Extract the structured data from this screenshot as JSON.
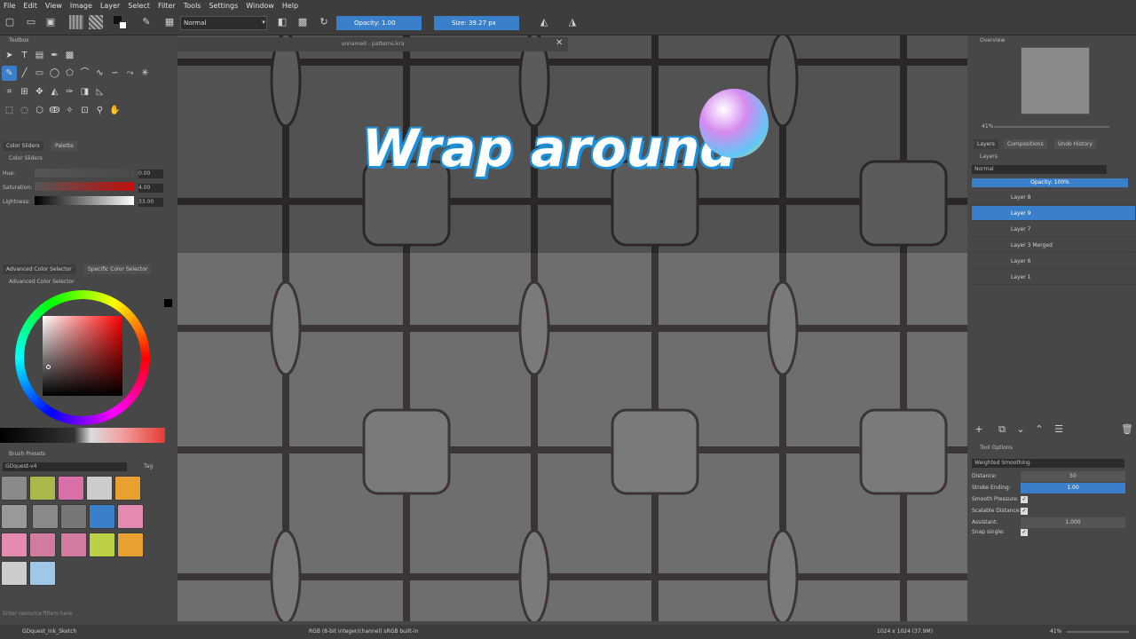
{
  "menu": [
    "File",
    "Edit",
    "View",
    "Image",
    "Layer",
    "Select",
    "Filter",
    "Tools",
    "Settings",
    "Window",
    "Help"
  ],
  "toolbar": {
    "blend_mode": "Normal",
    "opacity_label": "Opacity:  1.00",
    "size_label": "Size:  39.27 px"
  },
  "document": {
    "tab_title": "unnamed - patterns.kra"
  },
  "left": {
    "toolbox_title": "Toolbox",
    "color_tabs": [
      "Color Sliders",
      "Palette"
    ],
    "color_sliders_title": "Color Sliders",
    "sliders": [
      {
        "label": "Hue:",
        "value": "0.00"
      },
      {
        "label": "Saturation:",
        "value": "4.00"
      },
      {
        "label": "Lightness:",
        "value": "33.00"
      }
    ],
    "selector_tabs": [
      "Advanced Color Selector",
      "Specific Color Selector"
    ],
    "advanced_title": "Advanced Color Selector",
    "brush_presets_title": "Brush Presets",
    "brush_tag_value": "GDquest-v4",
    "tag_label": "Tag",
    "filter_placeholder": "Enter resource filters here",
    "current_brush": "GDquest_Ink_Sketch"
  },
  "overlay": {
    "headline": "Wrap around"
  },
  "right": {
    "overview_title": "Overview",
    "zoom": "41%",
    "tabs": [
      "Layers",
      "Compositions",
      "Undo History"
    ],
    "layers_title": "Layers",
    "blend": "Normal",
    "opacity": "Opacity:  100%",
    "layers": [
      "Layer 8",
      "Layer 9",
      "Layer 7",
      "Layer 3 Merged",
      "Layer 6",
      "Layer 1"
    ],
    "tool_options_title": "Tool Options",
    "smoothing": "Weighted Smoothing",
    "options": [
      {
        "label": "Distance:",
        "value": "50"
      },
      {
        "label": "Stroke Ending:",
        "value": "1.00"
      },
      {
        "label": "Smooth Pressure:",
        "value": ""
      },
      {
        "label": "Scalable Distance:",
        "value": ""
      },
      {
        "label": "Assistant:",
        "value": "1.000"
      },
      {
        "label": "Snap single:",
        "value": ""
      }
    ]
  },
  "status": {
    "brush": "GDquest_Ink_Sketch",
    "color_space": "RGB (8-bit integer/channel)  sRGB built-in",
    "dimensions": "1024 x 1024 (37.9M)",
    "zoom": "41%"
  }
}
